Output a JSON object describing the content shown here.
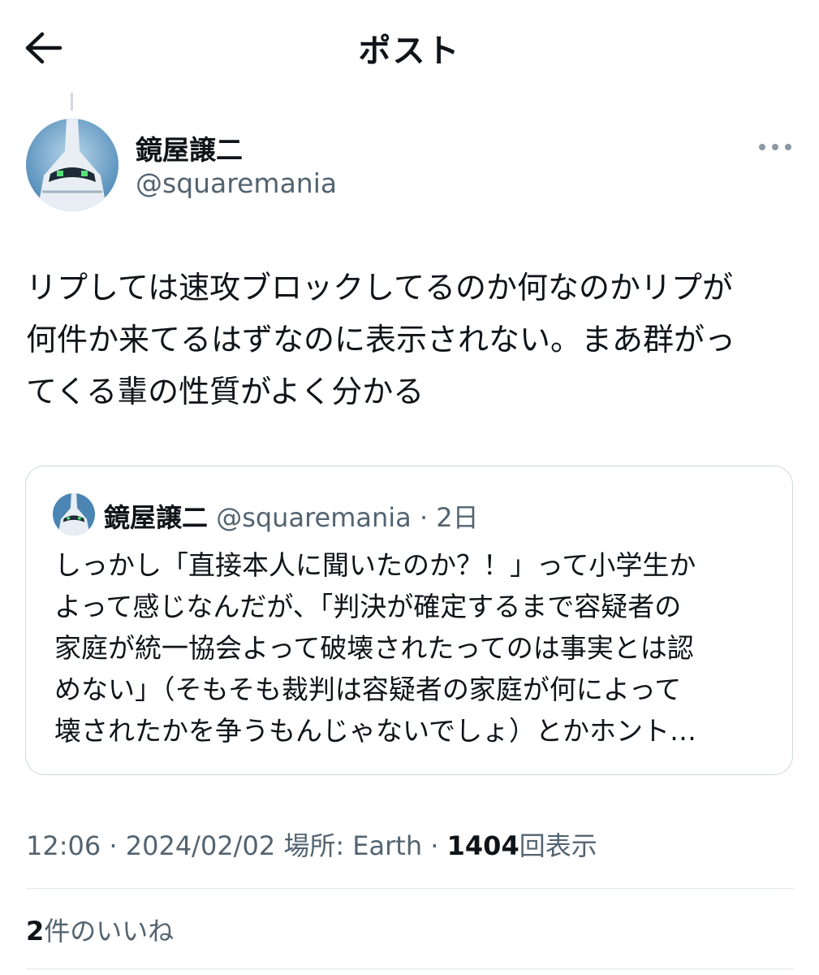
{
  "header": {
    "title": "ポスト",
    "back_icon": "arrow-left-icon"
  },
  "post": {
    "author": {
      "name": "鏡屋譲二",
      "handle": "@squaremania"
    },
    "text_lines": [
      "リプしては速攻ブロックしてるのか何なのかリプが",
      "何件か来てるはずなのに表示されない。まあ群がっ",
      "てくる輩の性質がよく分かる"
    ],
    "quoted": {
      "author": {
        "name": "鏡屋譲二",
        "handle": "@squaremania"
      },
      "separator": "·",
      "time": "2日",
      "text_lines": [
        "しっかし「直接本人に聞いたのか？！」って小学生か",
        "よって感じなんだが、「判決が確定するまで容疑者の",
        "家庭が統一協会よって破壊されたってのは事実とは認",
        "めない」（そもそも裁判は容疑者の家庭が何によって",
        "壊されたかを争うもんじゃないでしょ）とかホント…"
      ]
    },
    "meta": {
      "time": "12:06",
      "separator": "·",
      "date": "2024/02/02",
      "location": "場所: Earth",
      "views_count": "1404",
      "views_label": "回表示"
    },
    "likes": {
      "count": "2",
      "label": "件のいいね"
    }
  },
  "colors": {
    "text": "#0f1419",
    "secondary": "#536471",
    "border": "#cfd9de"
  }
}
